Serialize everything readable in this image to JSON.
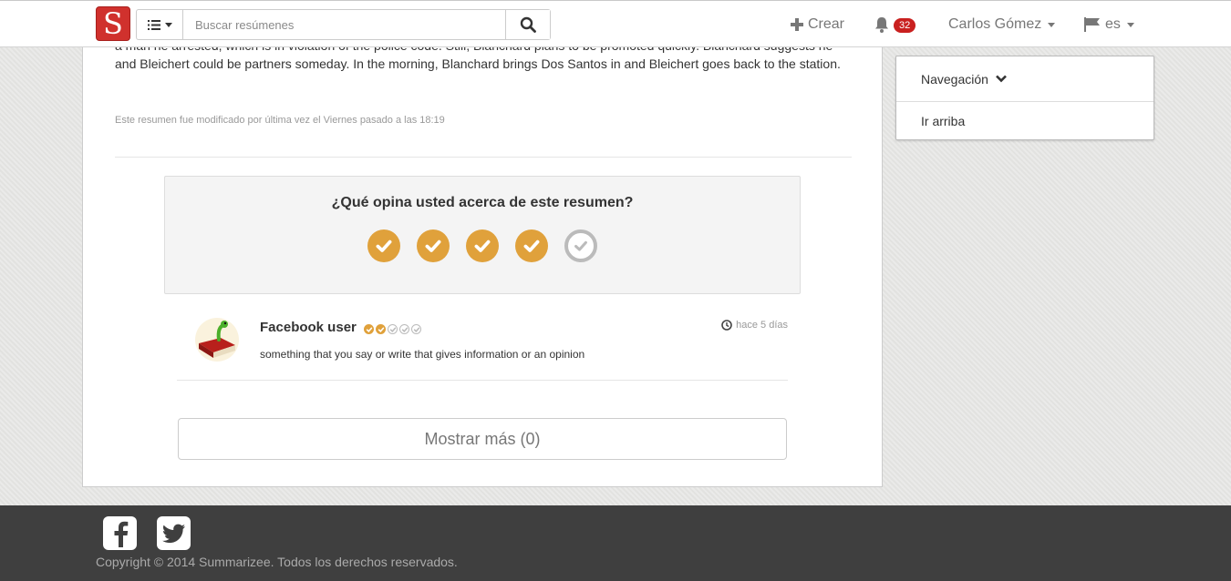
{
  "header": {
    "logo_letter": "S",
    "search_placeholder": "Buscar resúmenes",
    "create_label": "Crear",
    "notifications_count": "32",
    "user_name": "Carlos Gómez",
    "language": "es"
  },
  "summary": {
    "text": "a man he arrested, which is in violation of the police code. Still, Blanchard plans to be promoted quickly. Blanchard suggests he and Bleichert could be partners someday. In the morning, Blanchard brings Dos Santos in and Bleichert goes back to the station.",
    "modified_note": "Este resumen fue modificado por última vez el Viernes pasado a las 18:19"
  },
  "rating": {
    "question": "¿Qué opina usted acerca de este resumen?",
    "value": 4,
    "max": 5
  },
  "comment": {
    "author": "Facebook user",
    "rating": 2,
    "rating_max": 5,
    "time": "hace 5 días",
    "text": "something that you say or write that gives information or an opinion"
  },
  "show_more_label": "Mostrar más (0)",
  "sidebar": {
    "items": [
      {
        "label": "Navegación"
      },
      {
        "label": "Ir arriba"
      }
    ]
  },
  "footer": {
    "copyright": "Copyright © 2014 Summarizee. Todos los derechos reservados."
  },
  "colors": {
    "brand": "#d0312d",
    "accent": "#e0a13b",
    "badge": "#c9201f",
    "footer_bg": "#3f3f3f"
  }
}
